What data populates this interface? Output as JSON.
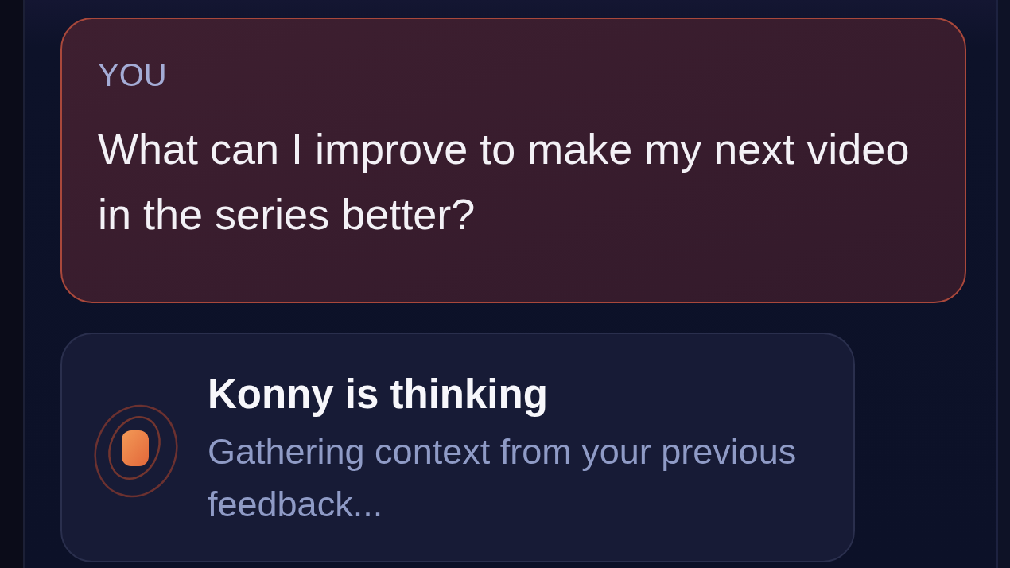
{
  "messages": [
    {
      "kind": "user",
      "sender": "YOU",
      "text": "What can I improve to make my next video in the series better?"
    }
  ],
  "status": {
    "kind": "thinking",
    "title": "Konny is thinking",
    "detail": "Gathering context from your previous feedback..."
  }
}
